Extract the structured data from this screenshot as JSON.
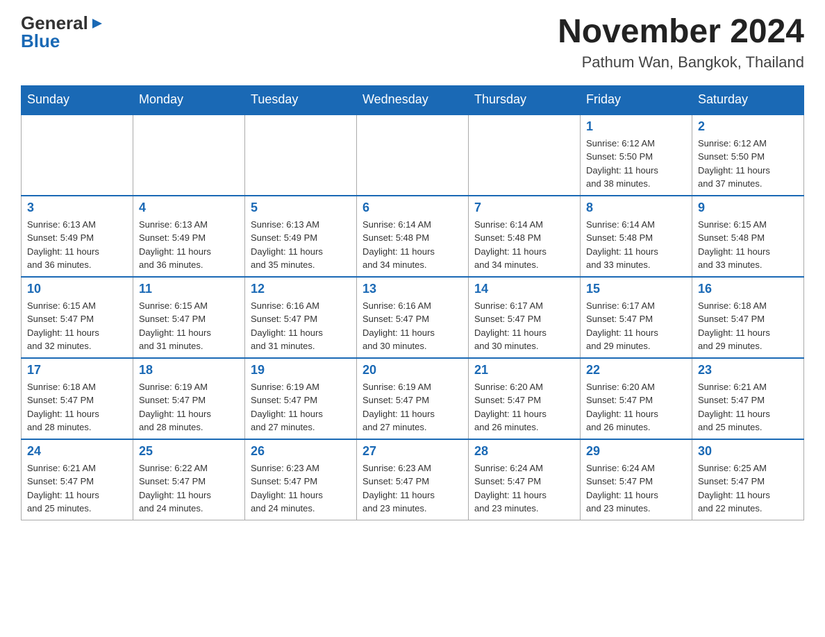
{
  "header": {
    "logo": {
      "general": "General",
      "blue": "Blue",
      "arrow": "▶"
    },
    "title": "November 2024",
    "location": "Pathum Wan, Bangkok, Thailand"
  },
  "calendar": {
    "days_of_week": [
      "Sunday",
      "Monday",
      "Tuesday",
      "Wednesday",
      "Thursday",
      "Friday",
      "Saturday"
    ],
    "weeks": [
      [
        {
          "day": "",
          "info": ""
        },
        {
          "day": "",
          "info": ""
        },
        {
          "day": "",
          "info": ""
        },
        {
          "day": "",
          "info": ""
        },
        {
          "day": "",
          "info": ""
        },
        {
          "day": "1",
          "info": "Sunrise: 6:12 AM\nSunset: 5:50 PM\nDaylight: 11 hours\nand 38 minutes."
        },
        {
          "day": "2",
          "info": "Sunrise: 6:12 AM\nSunset: 5:50 PM\nDaylight: 11 hours\nand 37 minutes."
        }
      ],
      [
        {
          "day": "3",
          "info": "Sunrise: 6:13 AM\nSunset: 5:49 PM\nDaylight: 11 hours\nand 36 minutes."
        },
        {
          "day": "4",
          "info": "Sunrise: 6:13 AM\nSunset: 5:49 PM\nDaylight: 11 hours\nand 36 minutes."
        },
        {
          "day": "5",
          "info": "Sunrise: 6:13 AM\nSunset: 5:49 PM\nDaylight: 11 hours\nand 35 minutes."
        },
        {
          "day": "6",
          "info": "Sunrise: 6:14 AM\nSunset: 5:48 PM\nDaylight: 11 hours\nand 34 minutes."
        },
        {
          "day": "7",
          "info": "Sunrise: 6:14 AM\nSunset: 5:48 PM\nDaylight: 11 hours\nand 34 minutes."
        },
        {
          "day": "8",
          "info": "Sunrise: 6:14 AM\nSunset: 5:48 PM\nDaylight: 11 hours\nand 33 minutes."
        },
        {
          "day": "9",
          "info": "Sunrise: 6:15 AM\nSunset: 5:48 PM\nDaylight: 11 hours\nand 33 minutes."
        }
      ],
      [
        {
          "day": "10",
          "info": "Sunrise: 6:15 AM\nSunset: 5:47 PM\nDaylight: 11 hours\nand 32 minutes."
        },
        {
          "day": "11",
          "info": "Sunrise: 6:15 AM\nSunset: 5:47 PM\nDaylight: 11 hours\nand 31 minutes."
        },
        {
          "day": "12",
          "info": "Sunrise: 6:16 AM\nSunset: 5:47 PM\nDaylight: 11 hours\nand 31 minutes."
        },
        {
          "day": "13",
          "info": "Sunrise: 6:16 AM\nSunset: 5:47 PM\nDaylight: 11 hours\nand 30 minutes."
        },
        {
          "day": "14",
          "info": "Sunrise: 6:17 AM\nSunset: 5:47 PM\nDaylight: 11 hours\nand 30 minutes."
        },
        {
          "day": "15",
          "info": "Sunrise: 6:17 AM\nSunset: 5:47 PM\nDaylight: 11 hours\nand 29 minutes."
        },
        {
          "day": "16",
          "info": "Sunrise: 6:18 AM\nSunset: 5:47 PM\nDaylight: 11 hours\nand 29 minutes."
        }
      ],
      [
        {
          "day": "17",
          "info": "Sunrise: 6:18 AM\nSunset: 5:47 PM\nDaylight: 11 hours\nand 28 minutes."
        },
        {
          "day": "18",
          "info": "Sunrise: 6:19 AM\nSunset: 5:47 PM\nDaylight: 11 hours\nand 28 minutes."
        },
        {
          "day": "19",
          "info": "Sunrise: 6:19 AM\nSunset: 5:47 PM\nDaylight: 11 hours\nand 27 minutes."
        },
        {
          "day": "20",
          "info": "Sunrise: 6:19 AM\nSunset: 5:47 PM\nDaylight: 11 hours\nand 27 minutes."
        },
        {
          "day": "21",
          "info": "Sunrise: 6:20 AM\nSunset: 5:47 PM\nDaylight: 11 hours\nand 26 minutes."
        },
        {
          "day": "22",
          "info": "Sunrise: 6:20 AM\nSunset: 5:47 PM\nDaylight: 11 hours\nand 26 minutes."
        },
        {
          "day": "23",
          "info": "Sunrise: 6:21 AM\nSunset: 5:47 PM\nDaylight: 11 hours\nand 25 minutes."
        }
      ],
      [
        {
          "day": "24",
          "info": "Sunrise: 6:21 AM\nSunset: 5:47 PM\nDaylight: 11 hours\nand 25 minutes."
        },
        {
          "day": "25",
          "info": "Sunrise: 6:22 AM\nSunset: 5:47 PM\nDaylight: 11 hours\nand 24 minutes."
        },
        {
          "day": "26",
          "info": "Sunrise: 6:23 AM\nSunset: 5:47 PM\nDaylight: 11 hours\nand 24 minutes."
        },
        {
          "day": "27",
          "info": "Sunrise: 6:23 AM\nSunset: 5:47 PM\nDaylight: 11 hours\nand 23 minutes."
        },
        {
          "day": "28",
          "info": "Sunrise: 6:24 AM\nSunset: 5:47 PM\nDaylight: 11 hours\nand 23 minutes."
        },
        {
          "day": "29",
          "info": "Sunrise: 6:24 AM\nSunset: 5:47 PM\nDaylight: 11 hours\nand 23 minutes."
        },
        {
          "day": "30",
          "info": "Sunrise: 6:25 AM\nSunset: 5:47 PM\nDaylight: 11 hours\nand 22 minutes."
        }
      ]
    ]
  }
}
